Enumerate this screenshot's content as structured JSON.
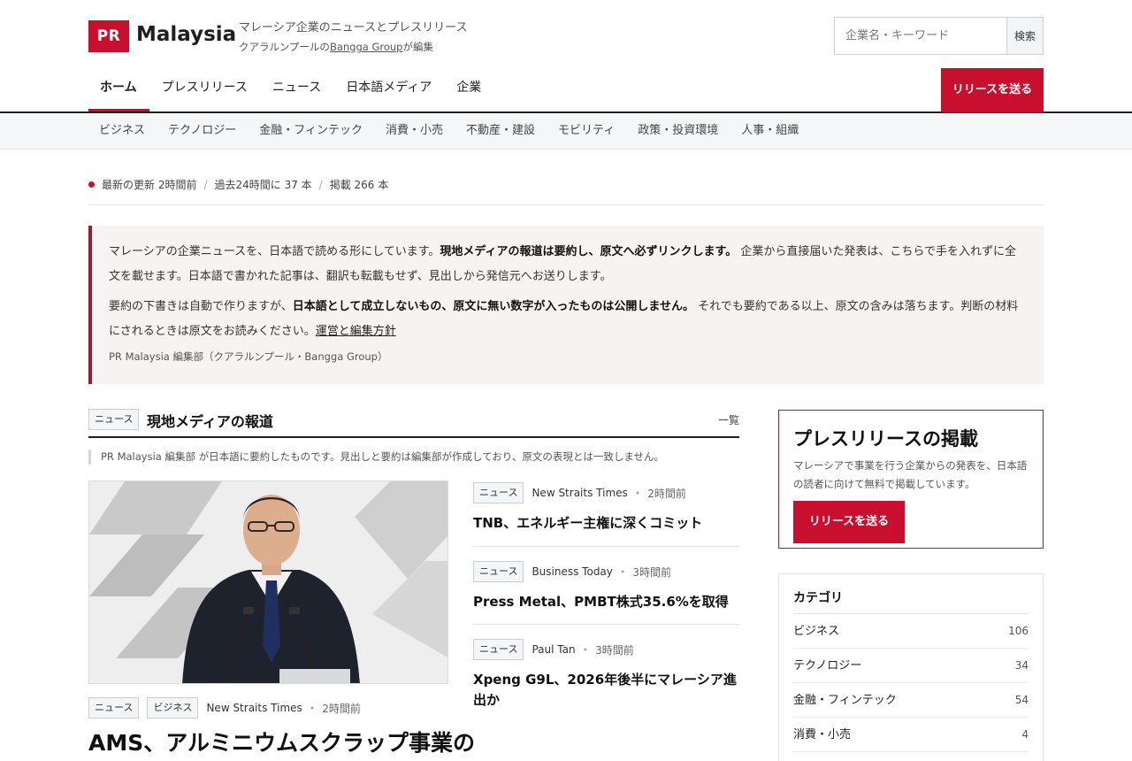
{
  "brand": {
    "badge": "PR",
    "name": "Malaysia",
    "tagline": "マレーシア企業のニュースとプレスリリース",
    "editor_prefix": "クアラルンプールの",
    "editor_name": "Bangga Group",
    "editor_suffix": "が編集",
    "accent_color": "#c8102e"
  },
  "search": {
    "placeholder": "企業名・キーワード",
    "button": "検索"
  },
  "main_nav": {
    "items": [
      "ホーム",
      "プレスリリース",
      "ニュース",
      "日本語メディア",
      "企業"
    ],
    "active": "ホーム",
    "cta": "リリースを送る"
  },
  "sub_nav": {
    "items": [
      "ビジネス",
      "テクノロジー",
      "金融・フィンテック",
      "消費・小売",
      "不動産・建設",
      "モビリティ",
      "政策・投資環境",
      "人事・組織"
    ]
  },
  "stats": {
    "latest": "最新の更新 2時間前",
    "last24": "過去24時間に 37 本",
    "total": "掲載 266 本"
  },
  "notice": {
    "p1_a": "マレーシアの企業ニュースを、日本語で読める形にしています。",
    "p1_b": "現地メディアの報道は要約し、原文へ必ずリンクします。",
    "p1_c": " 企業から直接届いた発表は、こちらで手を入れずに全文を載せます。日本語で書かれた記事は、翻訳も転載もせず、見出しから発信元へお送りします。",
    "p2_a": "要約の下書きは自動で作りますが、",
    "p2_b": "日本語として成立しないもの、原文に無い数字が入ったものは公開しません。",
    "p2_c": " それでも要約である以上、原文の含みは落ちます。判断の材料にされるときは原文をお読みください。",
    "p2_link": "運営と編集方針",
    "signature": "PR Malaysia 編集部（クアラルンプール・Bangga Group）"
  },
  "section": {
    "tag": "ニュース",
    "title": "現地メディアの報道",
    "more": "一覧",
    "note": "PR Malaysia 編集部 が日本語に要約したものです。見出しと要約は編集部が作成しており、原文の表現とは一致しません。"
  },
  "featured": {
    "tags": [
      "ニュース",
      "ビジネス"
    ],
    "source": "New Straits Times",
    "time": "2時間前",
    "title": "AMS、アルミニウムスクラップ事業の"
  },
  "news": [
    {
      "tag": "ニュース",
      "source": "New Straits Times",
      "time": "2時間前",
      "title": "TNB、エネルギー主権に深くコミット"
    },
    {
      "tag": "ニュース",
      "source": "Business Today",
      "time": "3時間前",
      "title": "Press Metal、PMBT株式35.6%を取得"
    },
    {
      "tag": "ニュース",
      "source": "Paul Tan",
      "time": "3時間前",
      "title": "Xpeng G9L、2026年後半にマレーシア進出か"
    }
  ],
  "cta_card": {
    "title": "プレスリリースの掲載",
    "desc": "マレーシアで事業を行う企業からの発表を、日本語の読者に向けて無料で掲載しています。",
    "button": "リリースを送る"
  },
  "categories": {
    "title": "カテゴリ",
    "items": [
      {
        "name": "ビジネス",
        "count": "106"
      },
      {
        "name": "テクノロジー",
        "count": "34"
      },
      {
        "name": "金融・フィンテック",
        "count": "54"
      },
      {
        "name": "消費・小売",
        "count": "4"
      }
    ]
  }
}
